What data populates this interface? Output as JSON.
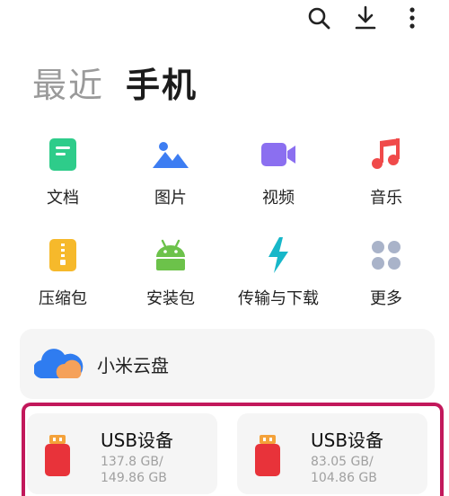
{
  "toolbar": {
    "icons": [
      "search-icon",
      "download-icon",
      "more-vertical-icon"
    ]
  },
  "tabs": [
    {
      "label": "最近",
      "active": false
    },
    {
      "label": "手机",
      "active": true
    }
  ],
  "categories": [
    {
      "label": "文档",
      "icon": "document-icon",
      "color": "#2ecc8a"
    },
    {
      "label": "图片",
      "icon": "image-icon",
      "color": "#3d7df2"
    },
    {
      "label": "视频",
      "icon": "video-icon",
      "color": "#8b6ff0"
    },
    {
      "label": "音乐",
      "icon": "music-icon",
      "color": "#f04a4a"
    },
    {
      "label": "压缩包",
      "icon": "zip-icon",
      "color": "#f6b92b"
    },
    {
      "label": "安装包",
      "icon": "android-icon",
      "color": "#6cc24a"
    },
    {
      "label": "传输与下载",
      "icon": "transfer-icon",
      "color": "#17b7c9"
    },
    {
      "label": "更多",
      "icon": "more-grid-icon",
      "color": "#a9b3c9"
    }
  ],
  "cloud": {
    "label": "小米云盘",
    "icon": "cloud-icon"
  },
  "usb_devices": [
    {
      "title": "USB设备",
      "size_line1": "137.8 GB/",
      "size_line2": "149.86 GB"
    },
    {
      "title": "USB设备",
      "size_line1": "83.05 GB/",
      "size_line2": "104.86 GB"
    }
  ],
  "colors": {
    "highlight_border": "#c2185b",
    "card_bg": "#f5f5f5",
    "inactive_tab": "#9a9a9a"
  }
}
